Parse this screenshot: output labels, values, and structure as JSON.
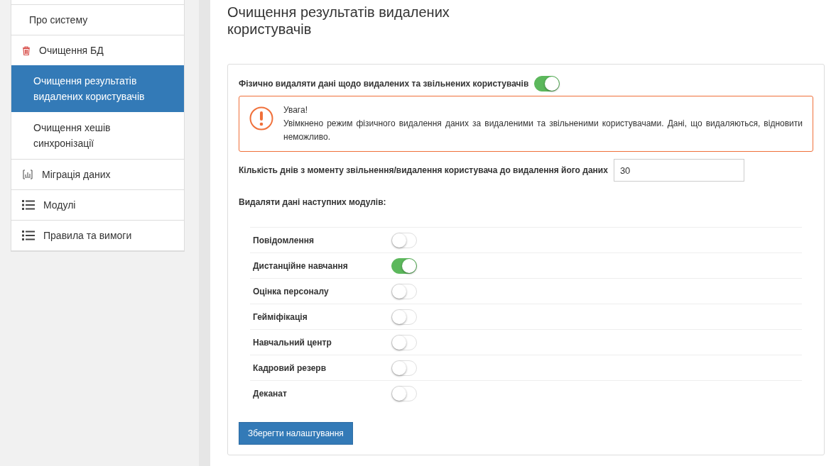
{
  "sidebar": {
    "items": [
      {
        "label": "Про систему",
        "kind": "plain"
      },
      {
        "label": "Очищення БД",
        "kind": "trash",
        "children": [
          {
            "label": "Очищення результатів видалених користувачів",
            "selected": true
          },
          {
            "label": "Очищення хешів синхронізації",
            "selected": false
          }
        ]
      },
      {
        "label": "Міграція даних",
        "kind": "migration"
      },
      {
        "label": "Модулі",
        "kind": "list"
      },
      {
        "label": "Правила та вимоги",
        "kind": "list"
      }
    ]
  },
  "page": {
    "title": "Очищення результатів видалених користувачів"
  },
  "settings": {
    "physical_delete": {
      "label": "Фізично видаляти дані щодо видалених та звільнених користувачів",
      "on": true
    },
    "warning": {
      "title": "Увага!",
      "text": "Увімкнено режим фізичного видалення даних за видаленими та звільненими користувачами. Дані, що видаляються, відновити неможливо."
    },
    "days": {
      "label": "Кількість днів з моменту звільнення/видалення користувача до видалення його даних",
      "value": "30"
    },
    "modules_heading": "Видаляти дані наступних модулів:",
    "modules": [
      {
        "label": "Повідомлення",
        "on": false
      },
      {
        "label": "Дистанційне навчання",
        "on": true
      },
      {
        "label": "Оцінка персоналу",
        "on": false
      },
      {
        "label": "Гейміфікація",
        "on": false
      },
      {
        "label": "Навчальний центр",
        "on": false
      },
      {
        "label": "Кадровий резерв",
        "on": false
      },
      {
        "label": "Деканат",
        "on": false
      }
    ],
    "save_button": "Зберегти налаштування"
  }
}
